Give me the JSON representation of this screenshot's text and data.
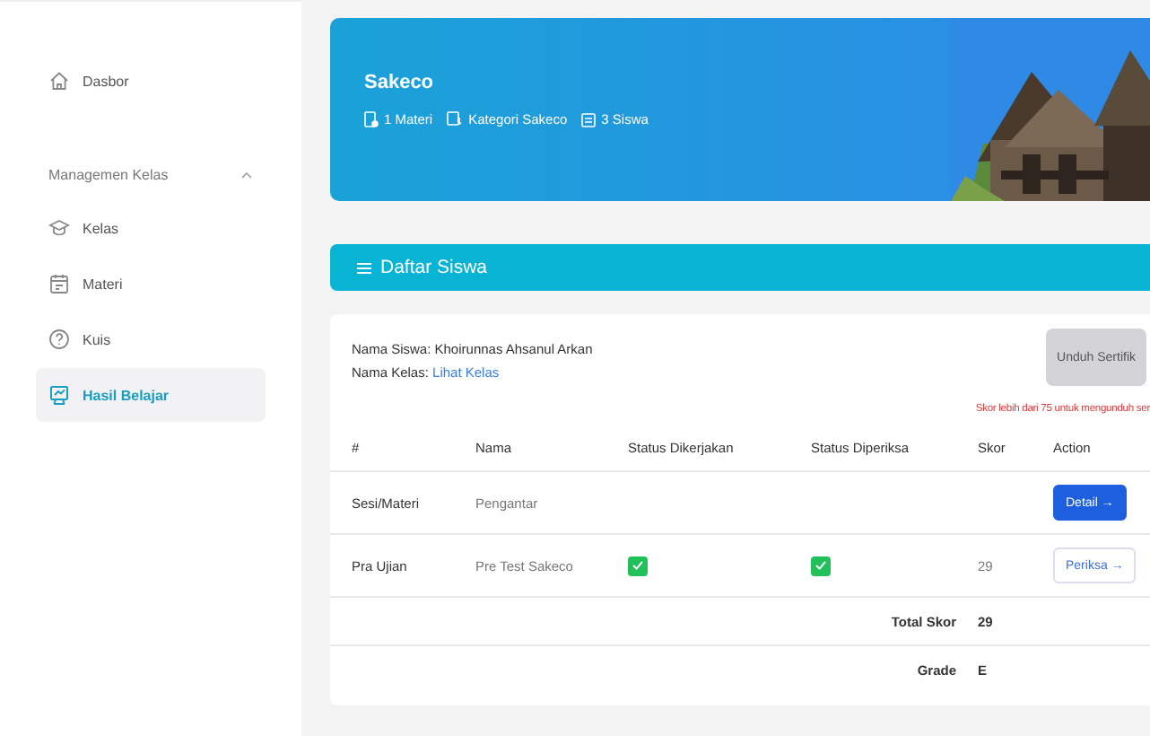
{
  "sidebar": {
    "items": [
      {
        "label": "Dasbor",
        "selected": false
      }
    ],
    "section": {
      "label": "Managemen Kelas",
      "expanded": true,
      "items": [
        {
          "label": "Kelas",
          "selected": false
        },
        {
          "label": "Materi",
          "selected": false
        },
        {
          "label": "Kuis",
          "selected": false
        },
        {
          "label": "Hasil Belajar",
          "selected": true
        }
      ]
    }
  },
  "banner": {
    "title": "Sakeco",
    "meta": [
      "1 Materi",
      "Kategori Sakeco",
      "3 Siswa"
    ],
    "image": {
      "kind": "picture"
    }
  },
  "section_header": {
    "title": "Daftar Siswa"
  },
  "result": {
    "student": "Nama Siswa: Khoirunnas Ahsanul Arkan",
    "class_label": "Nama Kelas:",
    "class_link": "Lihat Kelas",
    "certificate_button": {
      "label": "Unduh Sertifik",
      "disabled": true
    },
    "note": "Skor lebih dari 75 untuk mengunduh ser",
    "table": {
      "columns": [
        "#",
        "Nama",
        "Status Dikerjakan",
        "Status Diperiksa",
        "Skor",
        "Action"
      ],
      "rows": [
        {
          "kind": "session",
          "type": "Sesi/Materi",
          "name": "Pengantar",
          "action": {
            "label": "Detail →",
            "kind": "primary"
          }
        },
        {
          "kind": "quiz",
          "type": "Pra Ujian",
          "name": "Pre Test Sakeco",
          "done": true,
          "checked": true,
          "score": "29",
          "action": {
            "label": "Periksa →",
            "kind": "outline"
          }
        }
      ],
      "summary": [
        {
          "label": "Total Skor",
          "value": "29"
        },
        {
          "label": "Grade",
          "value": "E"
        }
      ]
    }
  }
}
